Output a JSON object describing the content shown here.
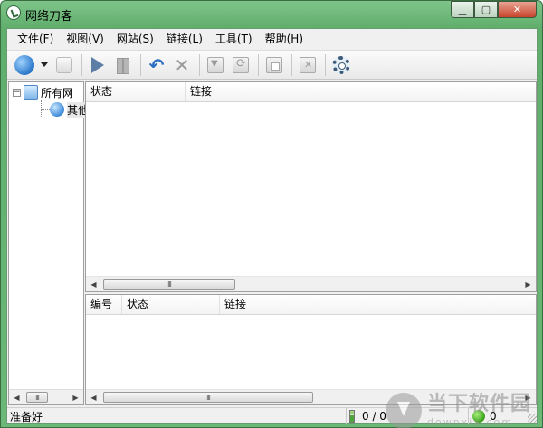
{
  "window": {
    "title": "网络刀客",
    "accent": "#6bb877"
  },
  "menu": [
    "文件(F)",
    "视图(V)",
    "网站(S)",
    "链接(L)",
    "工具(T)",
    "帮助(H)"
  ],
  "toolbar": {
    "icons": [
      "globe-icon",
      "dropdown-icon",
      "blank-page-icon",
      "play-icon",
      "pause-icon",
      "undo-icon",
      "delete-icon",
      "download-icon",
      "refresh-icon",
      "stop-icon",
      "remove-icon",
      "settings-icon"
    ]
  },
  "tree": {
    "root_label": "所有网",
    "child_label": "其他"
  },
  "top_list": {
    "columns": [
      "状态",
      "链接"
    ],
    "rows": []
  },
  "bottom_list": {
    "columns": [
      "编号",
      "状态",
      "链接"
    ],
    "rows": []
  },
  "status": {
    "ready": "准备好",
    "count": "0 / 0",
    "connections": "0"
  },
  "watermark": {
    "text": "当下软件园",
    "sub": "downxia.com"
  }
}
